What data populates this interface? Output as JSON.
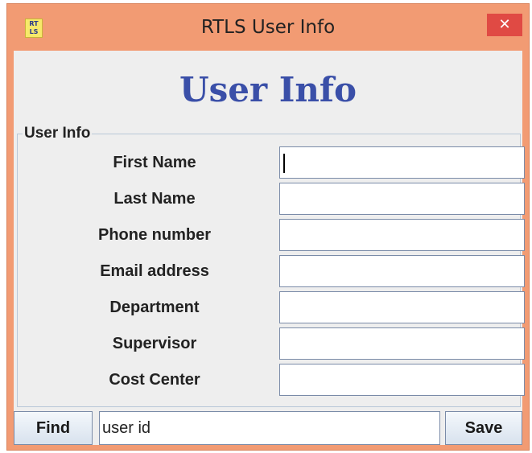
{
  "window": {
    "title": "RTLS User Info",
    "icon_text": "RT LS",
    "close_glyph": "✕"
  },
  "heading": "User Info",
  "group": {
    "legend": "User Info",
    "fields": [
      {
        "label": "First Name",
        "value": ""
      },
      {
        "label": "Last Name",
        "value": ""
      },
      {
        "label": "Phone number",
        "value": ""
      },
      {
        "label": "Email address",
        "value": ""
      },
      {
        "label": "Department",
        "value": ""
      },
      {
        "label": "Supervisor",
        "value": ""
      },
      {
        "label": "Cost Center",
        "value": ""
      }
    ]
  },
  "bottom": {
    "find_label": "Find",
    "user_id_value": "user id",
    "save_label": "Save"
  },
  "colors": {
    "window_frame": "#f29b73",
    "close_button": "#e04a44",
    "heading_text": "#3a4fa8",
    "client_background": "#eeeeee"
  },
  "icons": {
    "app_icon": "rtls-app-icon",
    "close": "close-icon"
  }
}
